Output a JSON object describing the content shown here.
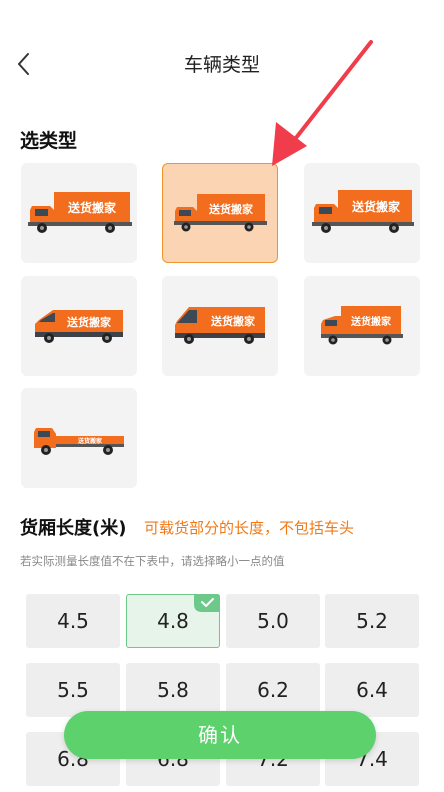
{
  "header": {
    "title": "车辆类型",
    "back_icon": "chevron-left-icon"
  },
  "vehicle_types": {
    "section_title": "选类型",
    "brand_text": "送货搬家",
    "selected_index": 1,
    "items": [
      {
        "kind": "box-truck"
      },
      {
        "kind": "box-truck-small"
      },
      {
        "kind": "box-truck-large"
      },
      {
        "kind": "van"
      },
      {
        "kind": "minibus"
      },
      {
        "kind": "small-box-truck"
      },
      {
        "kind": "flatbed-truck"
      }
    ]
  },
  "cargo_length": {
    "heading": "货厢长度(米)",
    "note": "可载货部分的长度，不包括车头",
    "hint": "若实际测量长度值不在下表中，请选择略小一点的值",
    "selected_value": "4.8",
    "values": [
      "4.5",
      "4.8",
      "5.0",
      "5.2",
      "5.5",
      "5.8",
      "6.2",
      "6.4",
      "6.8",
      "6.8",
      "7.2",
      "7.4"
    ]
  },
  "confirm_button": {
    "label": "确认"
  },
  "colors": {
    "accent_orange": "#f07a18",
    "selected_card_bg": "#fbd5b3",
    "selected_len_border": "#6cc98a",
    "confirm_green": "#5cd16c",
    "annotation_arrow": "#f03c4b"
  }
}
